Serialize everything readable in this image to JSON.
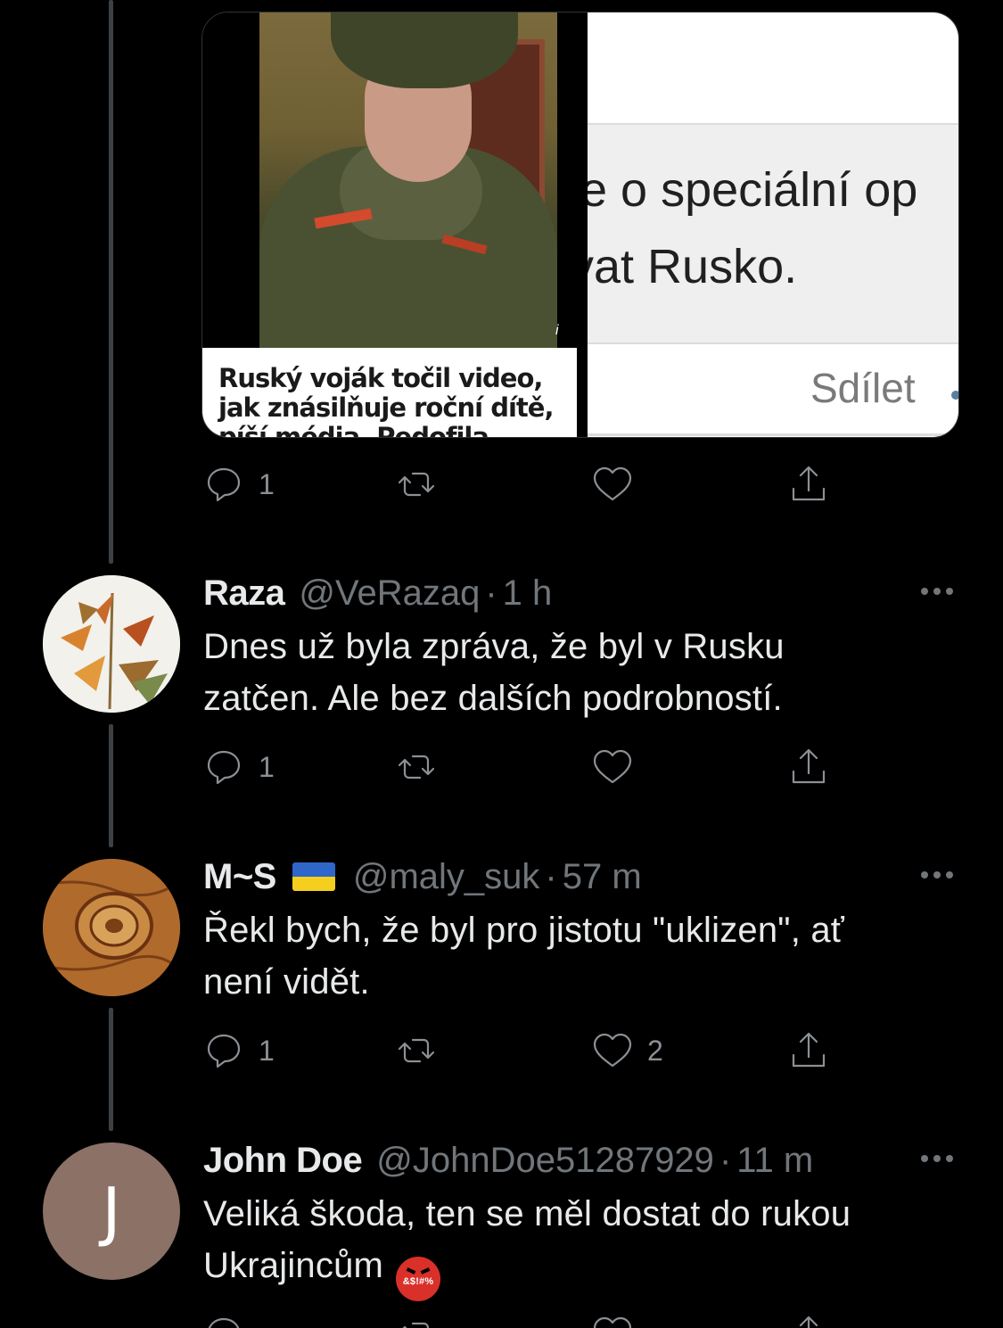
{
  "quoted_media": {
    "article_caption": "Ruský voják točil video, jak znásilňuje roční dítě, píší média. Pedofila zatkli",
    "info_glyph": "i",
    "screenshot_line1": "e o speciální op",
    "screenshot_line2": "vat Rusko.",
    "screenshot_share": "Sdílet"
  },
  "top_actions": {
    "reply_count": "1",
    "retweet_count": "",
    "like_count": ""
  },
  "tweets": [
    {
      "name": "Raza",
      "handle": "@VeRazaq",
      "separator": "·",
      "time": "1 h",
      "text_line1": "Dnes už byla zpráva, že byl v Rusku",
      "text_line2": "zatčen. Ale bez dalších podrobností.",
      "reply_count": "1",
      "retweet_count": "",
      "like_count": ""
    },
    {
      "name": "M~S",
      "flag": "ukraine-flag",
      "handle": "@maly_suk",
      "separator": "·",
      "time": "57 m",
      "text_line1": "Řekl bych, že byl pro jistotu \"uklizen\", ať",
      "text_line2": "není vidět.",
      "reply_count": "1",
      "retweet_count": "",
      "like_count": "2"
    },
    {
      "name": "John Doe",
      "handle": "@JohnDoe51287929",
      "separator": "·",
      "time": "11 m",
      "avatar_letter": "J",
      "text_line1": "Veliká škoda, ten se měl dostat do rukou",
      "text_line2": "Ukrajincům",
      "emoji": "&$!#%",
      "emoji_name": "face-with-symbols-on-mouth"
    }
  ],
  "colors": {
    "background": "#000000",
    "text": "#e7e9ea",
    "muted": "#71767b",
    "thread_line": "#3d4044",
    "avatar_john_bg": "#8c7167"
  }
}
